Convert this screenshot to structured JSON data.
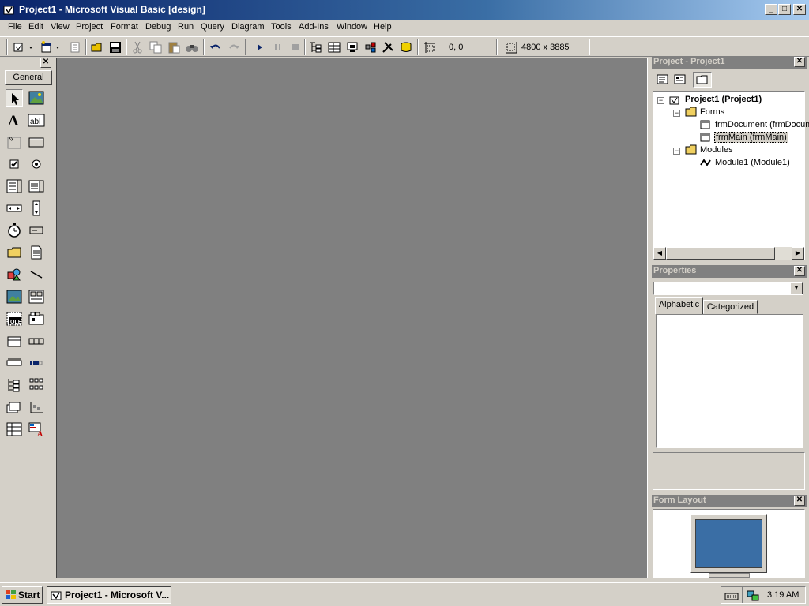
{
  "window": {
    "title": "Project1 - Microsoft Visual Basic [design]",
    "controls": [
      "minimize-icon",
      "maximize-icon",
      "close-icon"
    ]
  },
  "menu": {
    "items": [
      "File",
      "Edit",
      "View",
      "Project",
      "Format",
      "Debug",
      "Run",
      "Query",
      "Diagram",
      "Tools",
      "Add-Ins",
      "Window",
      "Help"
    ]
  },
  "toolbar": {
    "position": "0, 0",
    "size": "4800 x 3885",
    "icons": [
      "add-project-icon",
      "add-form-icon",
      "menu-editor-icon",
      "open-project-icon",
      "save-project-icon",
      "cut-icon",
      "copy-icon",
      "paste-icon",
      "find-icon",
      "undo-icon",
      "redo-icon",
      "start-icon",
      "break-icon",
      "end-icon",
      "project-explorer-icon",
      "properties-window-icon",
      "form-layout-icon",
      "object-browser-icon",
      "toolbox-icon",
      "data-view-icon",
      "position-icon",
      "size-icon"
    ]
  },
  "toolbox": {
    "tab_label": "General",
    "tools": [
      "pointer",
      "picturebox",
      "label",
      "textbox",
      "frame",
      "commandbutton",
      "checkbox",
      "optionbutton",
      "combobox",
      "listbox",
      "hscrollbar",
      "vscrollbar",
      "timer",
      "drivelistbox",
      "dirlistbox",
      "filelistbox",
      "shape",
      "line",
      "image",
      "data",
      "ole",
      "sstab",
      "toolbar",
      "statusbar",
      "progressbar",
      "slider",
      "treeview",
      "listview",
      "imagelist",
      "animation",
      "mschart",
      "richtextbox"
    ]
  },
  "project_panel": {
    "title": "Project - Project1",
    "tree": [
      {
        "label": "Project1 (Project1)",
        "level": 0,
        "bold": true
      },
      {
        "label": "Forms",
        "level": 1
      },
      {
        "label": "frmDocument (frmDocument)",
        "level": 2
      },
      {
        "label": "frmMain (frmMain)",
        "level": 2,
        "selected": true
      },
      {
        "label": "Modules",
        "level": 1
      },
      {
        "label": "Module1 (Module1)",
        "level": 2
      }
    ]
  },
  "properties_panel": {
    "title": "Properties",
    "tabs": [
      "Alphabetic",
      "Categorized"
    ],
    "active_tab": "Alphabetic"
  },
  "form_layout_panel": {
    "title": "Form Layout"
  },
  "taskbar": {
    "start_label": "Start",
    "task_label": "Project1 - Microsoft V...",
    "clock": "3:19 AM"
  },
  "colors": {
    "workspace": "#808080",
    "titlebar_start": "#0a246a",
    "titlebar_end": "#a6caf0",
    "form_layout_screen": "#3a6ea5",
    "chrome": "#d4d0c8"
  }
}
